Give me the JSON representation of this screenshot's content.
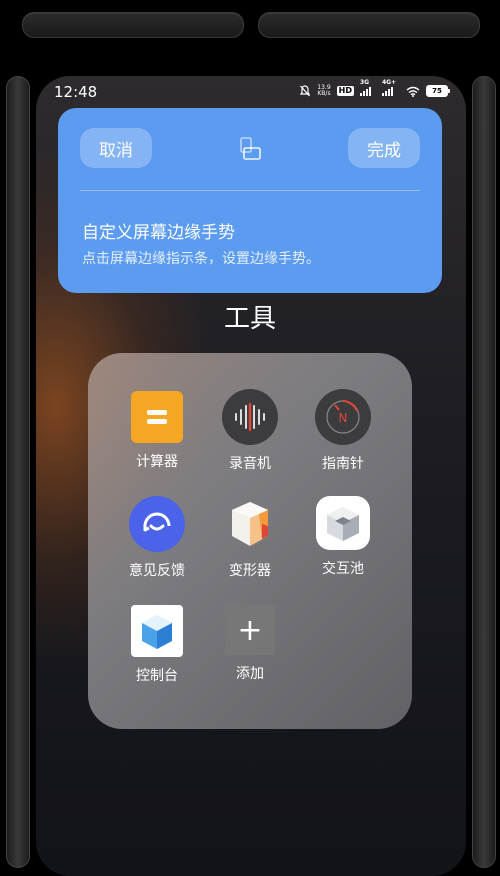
{
  "status_bar": {
    "time": "12:48",
    "net_speed_value": "13.9",
    "net_speed_unit": "KB/s",
    "hd_label": "HD",
    "sig1_label": "3G",
    "sig2_label": "4G+",
    "battery": "75"
  },
  "edit_card": {
    "cancel_label": "取消",
    "done_label": "完成",
    "title": "自定义屏幕边缘手势",
    "subtitle": "点击屏幕边缘指示条，设置边缘手势。"
  },
  "folder": {
    "title": "工具",
    "apps": [
      {
        "label": "计算器",
        "icon": "calculator-icon"
      },
      {
        "label": "录音机",
        "icon": "recorder-icon"
      },
      {
        "label": "指南针",
        "icon": "compass-icon"
      },
      {
        "label": "意见反馈",
        "icon": "feedback-icon"
      },
      {
        "label": "变形器",
        "icon": "transformer-icon"
      },
      {
        "label": "交互池",
        "icon": "interaction-pool-icon"
      },
      {
        "label": "控制台",
        "icon": "console-icon"
      },
      {
        "label": "添加",
        "icon": "plus-icon"
      }
    ]
  },
  "colors": {
    "card_blue": "#5b9bf0",
    "calculator_orange": "#f5a623",
    "feedback_blue": "#4a63e8",
    "compass_red": "#e0453a"
  }
}
